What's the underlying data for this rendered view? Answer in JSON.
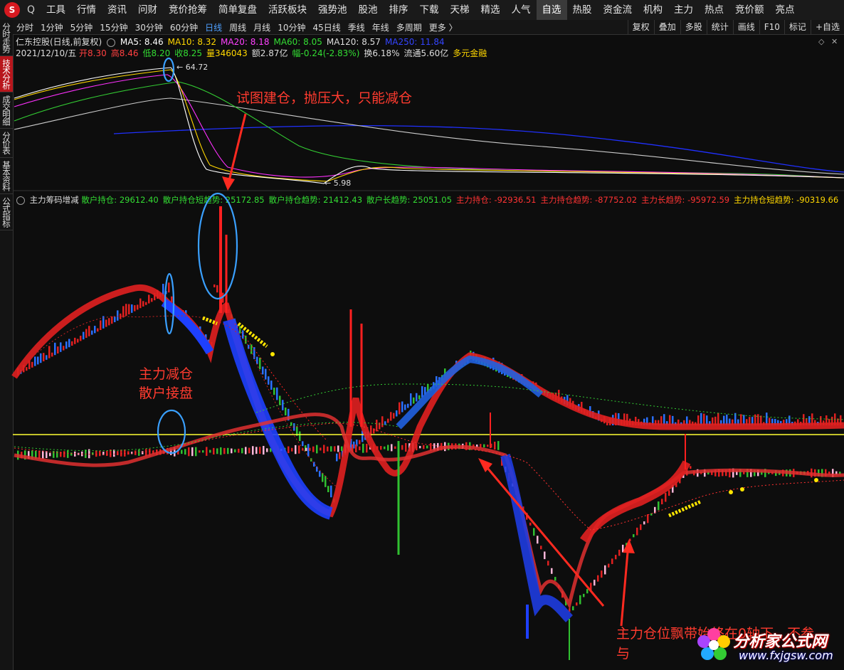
{
  "topbar": {
    "logo": "S",
    "search": "Q",
    "items": [
      "工具",
      "行情",
      "资讯",
      "问财",
      "竞价抢筹",
      "简单复盘",
      "活跃板块",
      "强势池",
      "股池",
      "排序",
      "下载",
      "天梯",
      "精选",
      "人气",
      "自选",
      "热股",
      "资金流",
      "机构",
      "主力",
      "热点",
      "竞价额",
      "亮点"
    ],
    "active": "自选"
  },
  "sidebar": {
    "tabs": [
      "分时走势",
      "技术分析",
      "成交明细",
      "分价表",
      "基本资料",
      "公式指标"
    ],
    "active": "技术分析"
  },
  "periods": {
    "items": [
      "分时",
      "1分钟",
      "5分钟",
      "15分钟",
      "30分钟",
      "60分钟",
      "日线",
      "周线",
      "月线",
      "10分钟",
      "45日线",
      "季线",
      "年线",
      "多周期",
      "更多 〉"
    ],
    "active": "日线"
  },
  "controls": [
    "复权",
    "叠加",
    "多股",
    "统计",
    "画线",
    "F10",
    "标记",
    "+自选"
  ],
  "stock": {
    "name": "仁东控股(日线,前复权)",
    "ma": [
      {
        "label": "MA5: 8.46",
        "color": "#ffffff"
      },
      {
        "label": "MA10: 8.32",
        "color": "#ffd700"
      },
      {
        "label": "MA20: 8.18",
        "color": "#ff40ff"
      },
      {
        "label": "MA60: 8.05",
        "color": "#33dd33"
      },
      {
        "label": "MA120: 8.57",
        "color": "#dddddd"
      },
      {
        "label": "MA250: 11.84",
        "color": "#3344ff"
      }
    ],
    "date": "2021/12/10/五",
    "stats": [
      {
        "label": "开8.30",
        "color": "#ff4040"
      },
      {
        "label": "高8.46",
        "color": "#ff4040"
      },
      {
        "label": "低8.20",
        "color": "#33dd33"
      },
      {
        "label": "收8.25",
        "color": "#33dd33"
      },
      {
        "label": "量346043",
        "color": "#ffd700"
      },
      {
        "label": "额2.87亿",
        "color": "#dddddd"
      },
      {
        "label": "幅-0.24(-2.83%)",
        "color": "#33dd33"
      },
      {
        "label": "换6.18%",
        "color": "#dddddd"
      },
      {
        "label": "流通5.60亿",
        "color": "#dddddd"
      },
      {
        "label": "多元金融",
        "color": "#ffd700"
      }
    ],
    "high_label": "64.72",
    "low_label": "5.98"
  },
  "indicator": {
    "name": "主力筹码增减",
    "values": [
      {
        "label": "散户持仓: 29612.40",
        "color": "#33dd33"
      },
      {
        "label": "散户持仓短趋势: 25172.85",
        "color": "#33dd33"
      },
      {
        "label": "散户持仓趋势: 21412.43",
        "color": "#33dd33"
      },
      {
        "label": "散户长趋势: 25051.05",
        "color": "#33dd33"
      },
      {
        "label": "主力持仓: -92936.51",
        "color": "#ff3333"
      },
      {
        "label": "主力持仓趋势: -87752.02",
        "color": "#ff3333"
      },
      {
        "label": "主力长趋势: -95972.59",
        "color": "#ff3333"
      },
      {
        "label": "主力持仓短趋势: -90319.66",
        "color": "#ffd700"
      }
    ]
  },
  "annotations": {
    "a1": "试图建仓，抛压大，只能减仓",
    "a2_line1": "主力减仓",
    "a2_line2": "散户接盘",
    "a3_line1": "主力仓位飘带始终在0轴下，不参",
    "a3_line2": "与"
  },
  "watermark": {
    "title": "分析家公式网",
    "url": "www.fxjgsw.com"
  }
}
